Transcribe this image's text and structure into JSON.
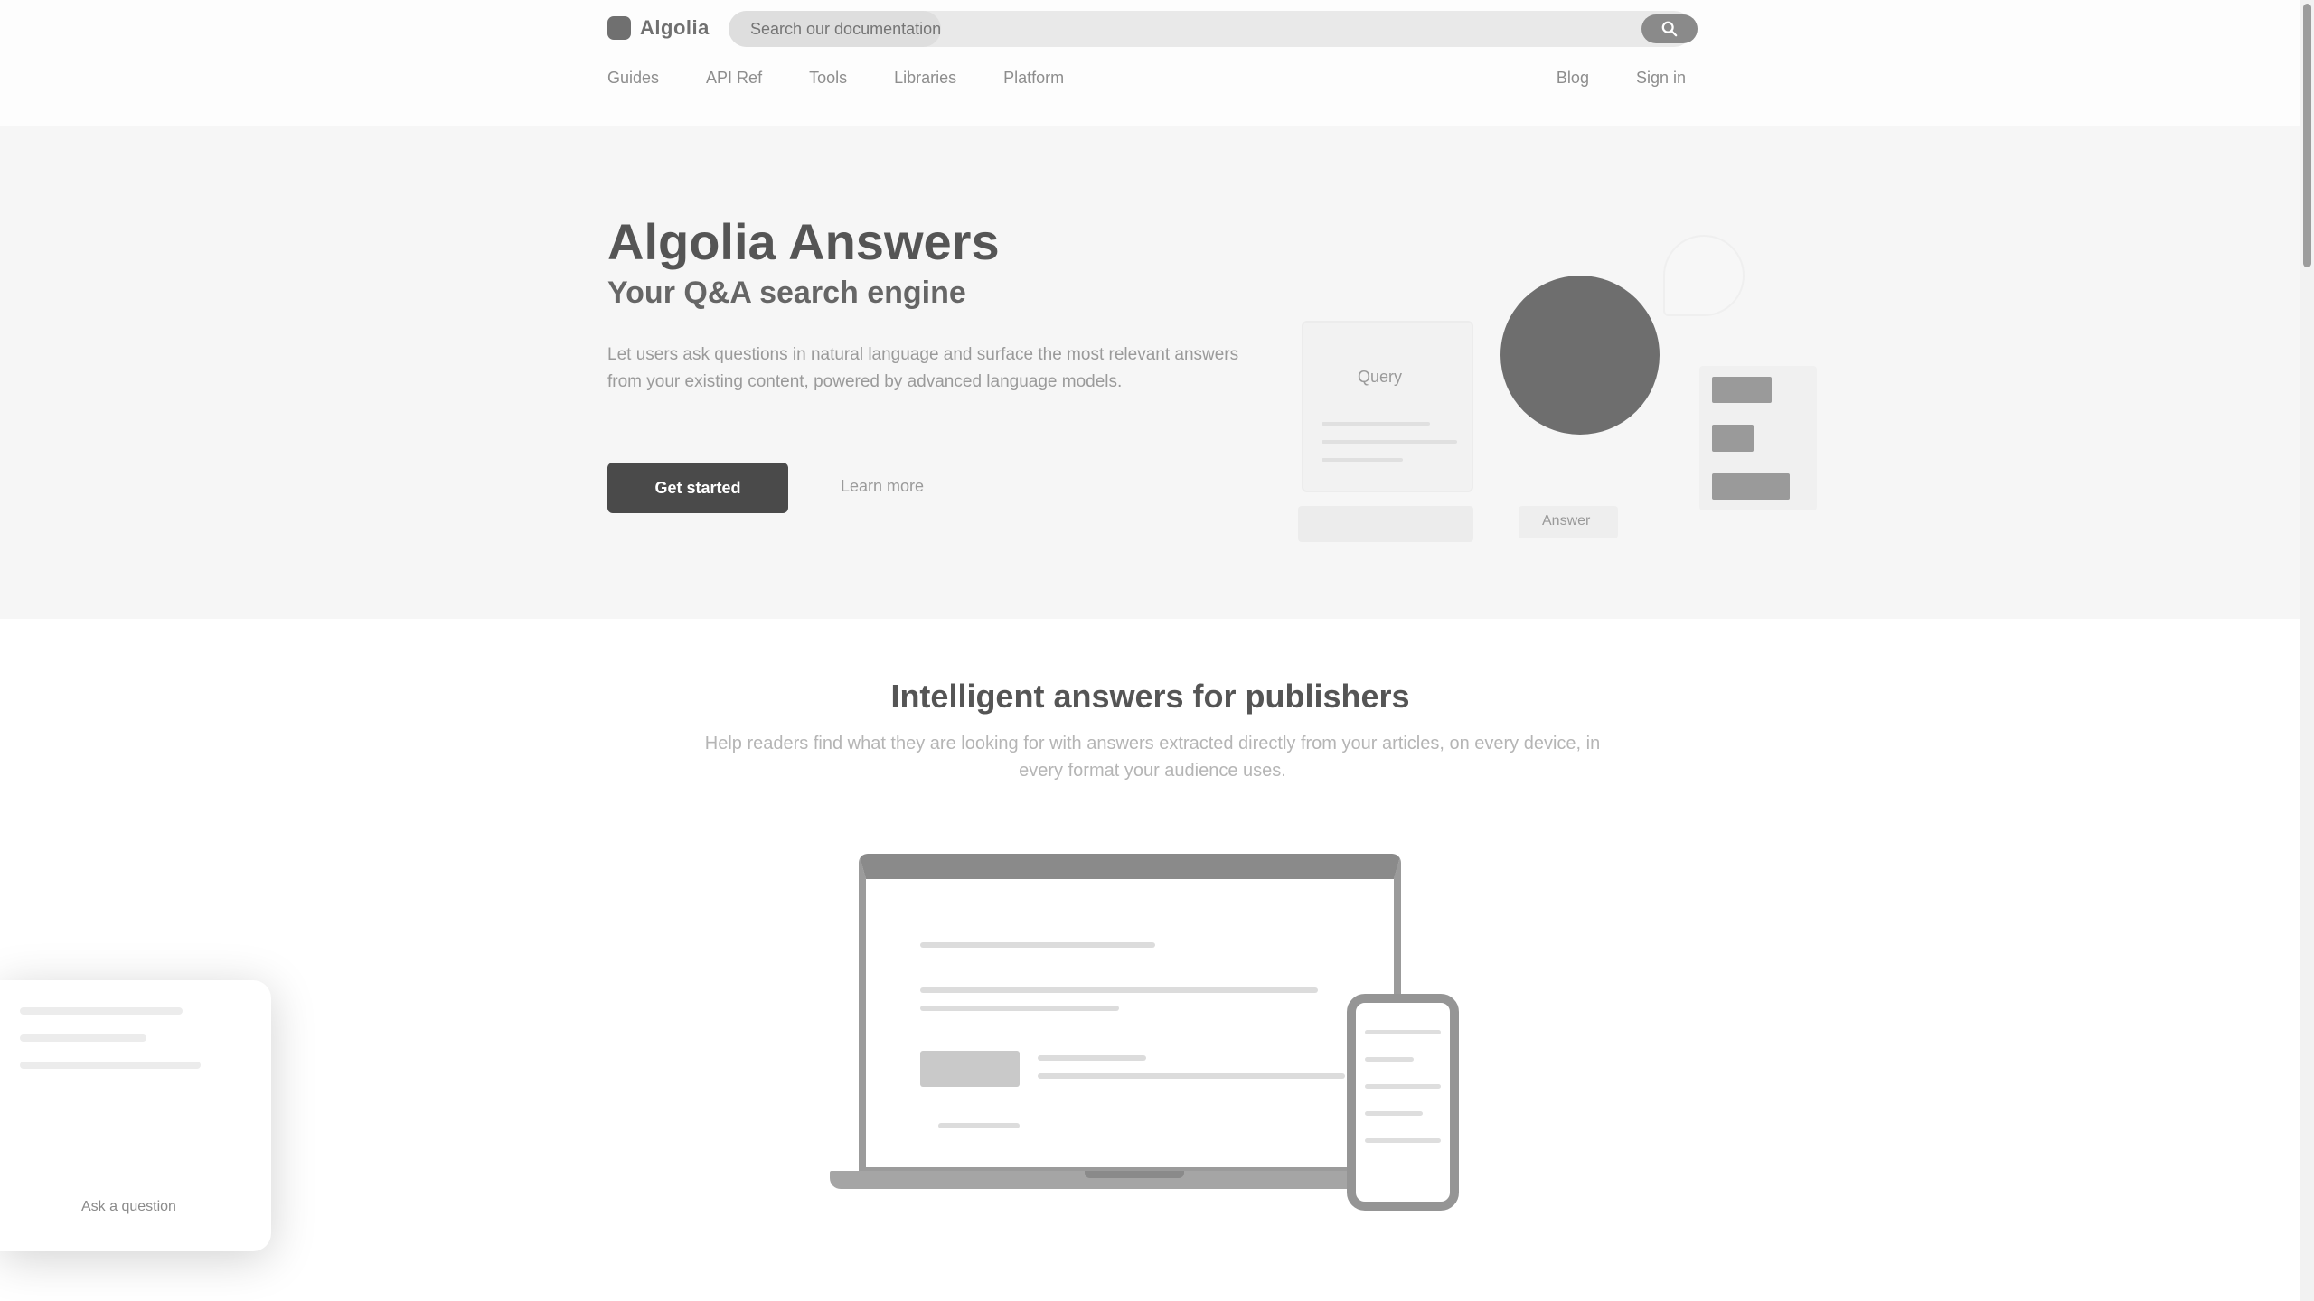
{
  "header": {
    "logo_text": "Algolia",
    "search": {
      "placeholder": "Search our documentation",
      "progress": 0.22
    },
    "nav_items": [
      "Guides",
      "API Ref",
      "Tools",
      "Libraries",
      "Platform"
    ],
    "nav_right": [
      "Blog",
      "Sign in"
    ]
  },
  "hero": {
    "title": "Algolia Answers",
    "subtitle": "Your Q&A search engine",
    "description": "Let users ask questions in natural language and surface the most relevant answers from your existing content, powered by advanced language models.",
    "cta_label": "Get started",
    "link_label": "Learn more",
    "illustration": {
      "card_label": "Query",
      "tab_label": "Answer",
      "bars": [
        0.55,
        0.3,
        0.8
      ]
    }
  },
  "section": {
    "title": "Intelligent answers for publishers",
    "description": "Help readers find what they are looking for with answers extracted directly from your articles, on every device, in every format your audience uses."
  },
  "chat": {
    "label": "Ask a question"
  },
  "colors": {
    "accent": "#4a4a4a",
    "hero_bg": "#f6f6f6",
    "circle": "#6e6e6e"
  }
}
